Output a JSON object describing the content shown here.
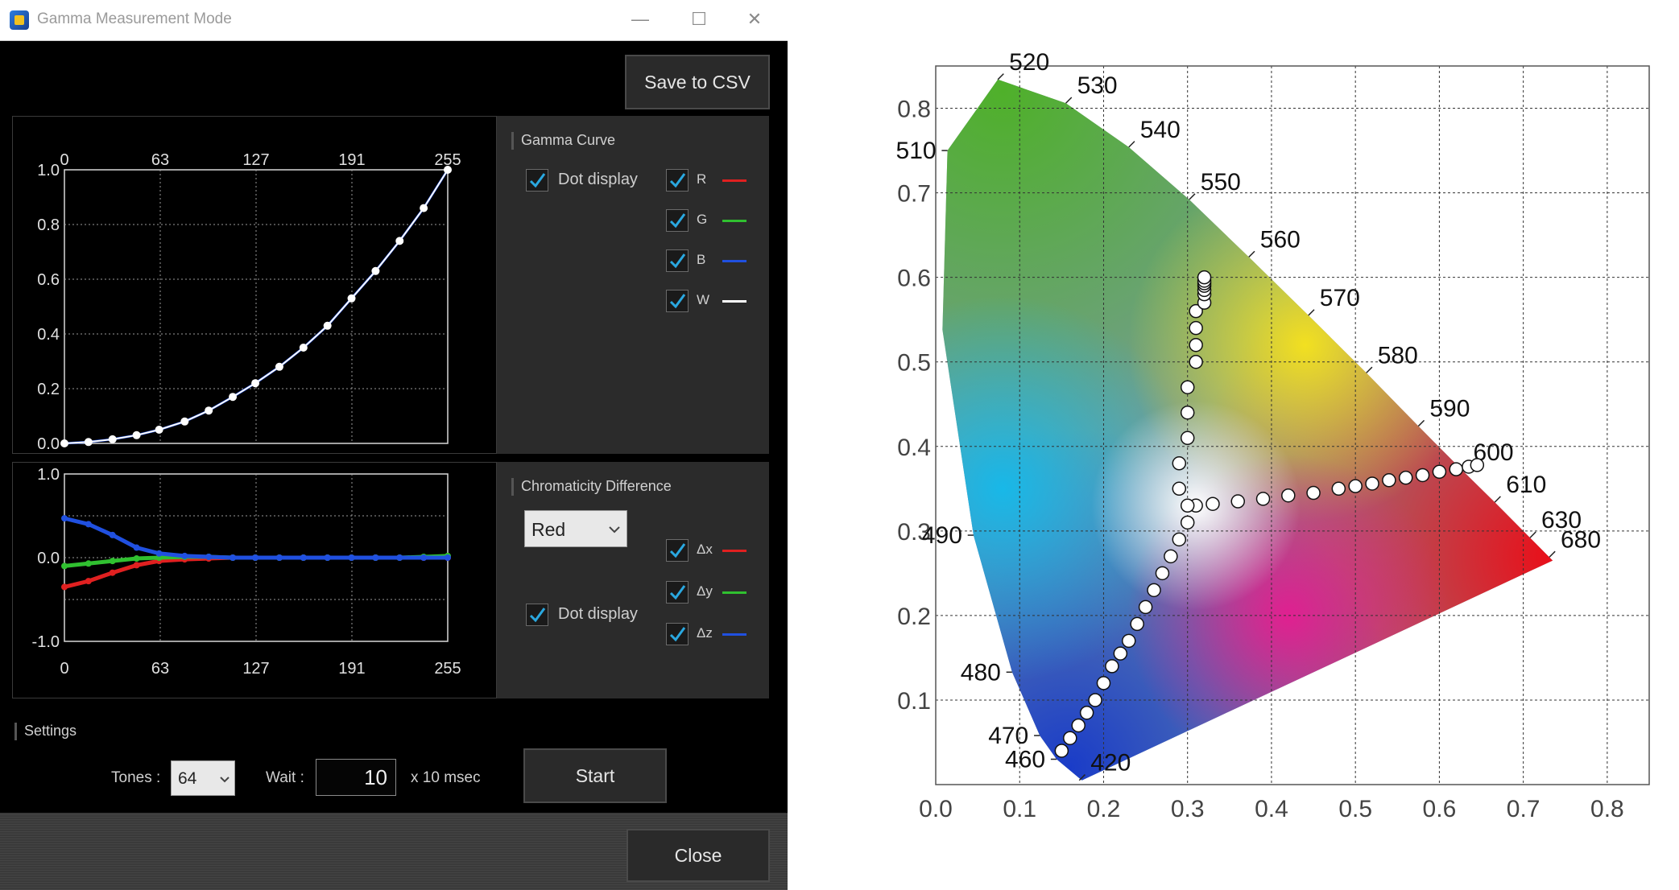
{
  "window": {
    "title": "Gamma Measurement Mode",
    "minimize_glyph": "—",
    "maximize_glyph": "☐",
    "close_glyph": "✕"
  },
  "toolbar": {
    "save_csv_label": "Save to CSV"
  },
  "gamma_chart": {
    "top_ticks": [
      "0",
      "63",
      "127",
      "191",
      "255"
    ],
    "y_ticks": [
      "1.0",
      "0.8",
      "0.6",
      "0.4",
      "0.2",
      "0.0"
    ]
  },
  "gamma_panel": {
    "title": "Gamma Curve",
    "dot_display_label": "Dot display",
    "channels": [
      {
        "label": "R",
        "color": "#e02020"
      },
      {
        "label": "G",
        "color": "#30c030"
      },
      {
        "label": "B",
        "color": "#2050e0"
      },
      {
        "label": "W",
        "color": "#ffffff"
      }
    ]
  },
  "diff_chart": {
    "y_ticks": [
      "1.0",
      "0.0",
      "-1.0"
    ],
    "x_ticks": [
      "0",
      "63",
      "127",
      "191",
      "255"
    ]
  },
  "diff_panel": {
    "title": "Chromaticity Difference",
    "color_select_value": "Red",
    "dot_display_label": "Dot display",
    "channels": [
      {
        "label": "Δx",
        "color": "#e02020"
      },
      {
        "label": "Δy",
        "color": "#30c030"
      },
      {
        "label": "Δz",
        "color": "#2050e0"
      }
    ]
  },
  "settings": {
    "title": "Settings",
    "tones_label": "Tones :",
    "tones_value": "64",
    "wait_label": "Wait :",
    "wait_value": "10",
    "wait_unit": "x  10 msec",
    "start_label": "Start"
  },
  "footer": {
    "close_label": "Close"
  },
  "chart_data": [
    {
      "type": "line",
      "x": [
        0,
        16,
        32,
        48,
        63,
        80,
        96,
        112,
        127,
        143,
        159,
        175,
        191,
        207,
        223,
        239,
        255
      ],
      "series": [
        {
          "name": "W",
          "values": [
            0.0,
            0.005,
            0.015,
            0.03,
            0.05,
            0.08,
            0.12,
            0.17,
            0.22,
            0.28,
            0.35,
            0.43,
            0.53,
            0.63,
            0.74,
            0.86,
            1.0
          ]
        }
      ],
      "xlim": [
        0,
        255
      ],
      "ylim": [
        0,
        1.0
      ],
      "grid": true
    },
    {
      "type": "line",
      "x": [
        0,
        16,
        32,
        48,
        63,
        80,
        96,
        112,
        127,
        143,
        159,
        175,
        191,
        207,
        223,
        239,
        255
      ],
      "series": [
        {
          "name": "Δx",
          "values": [
            -0.35,
            -0.28,
            -0.18,
            -0.09,
            -0.04,
            -0.02,
            -0.01,
            0.0,
            0.0,
            0.0,
            0.0,
            0.0,
            0.0,
            0.0,
            0.0,
            0.0,
            0.0
          ]
        },
        {
          "name": "Δy",
          "values": [
            -0.1,
            -0.07,
            -0.04,
            -0.01,
            0.0,
            0.01,
            0.01,
            0.0,
            0.0,
            0.0,
            0.0,
            0.0,
            0.0,
            0.0,
            0.0,
            0.01,
            0.02
          ]
        },
        {
          "name": "Δz",
          "values": [
            0.47,
            0.4,
            0.27,
            0.12,
            0.05,
            0.02,
            0.01,
            0.0,
            0.0,
            0.0,
            0.0,
            0.0,
            0.0,
            0.0,
            0.0,
            0.0,
            0.0
          ]
        }
      ],
      "xlim": [
        0,
        255
      ],
      "ylim": [
        -1.0,
        1.0
      ],
      "grid": true
    },
    {
      "type": "scatter",
      "x_ticks": [
        "0.0",
        "0.1",
        "0.2",
        "0.3",
        "0.4",
        "0.5",
        "0.6",
        "0.7",
        "0.8"
      ],
      "y_ticks": [
        "0.1",
        "0.2",
        "0.3",
        "0.4",
        "0.5",
        "0.6",
        "0.7",
        "0.8"
      ],
      "wavelength_labels": [
        {
          "label": "520",
          "x": 0.074,
          "y": 0.834
        },
        {
          "label": "530",
          "x": 0.155,
          "y": 0.806
        },
        {
          "label": "540",
          "x": 0.23,
          "y": 0.754
        },
        {
          "label": "550",
          "x": 0.302,
          "y": 0.692
        },
        {
          "label": "560",
          "x": 0.373,
          "y": 0.624
        },
        {
          "label": "570",
          "x": 0.444,
          "y": 0.555
        },
        {
          "label": "580",
          "x": 0.513,
          "y": 0.487
        },
        {
          "label": "590",
          "x": 0.575,
          "y": 0.424
        },
        {
          "label": "600",
          "x": 0.627,
          "y": 0.372
        },
        {
          "label": "610",
          "x": 0.666,
          "y": 0.334
        },
        {
          "label": "630",
          "x": 0.708,
          "y": 0.292
        },
        {
          "label": "680",
          "x": 0.731,
          "y": 0.269
        },
        {
          "label": "510",
          "x": 0.014,
          "y": 0.75
        },
        {
          "label": "490",
          "x": 0.045,
          "y": 0.295
        },
        {
          "label": "480",
          "x": 0.091,
          "y": 0.133
        },
        {
          "label": "470",
          "x": 0.124,
          "y": 0.058
        },
        {
          "label": "460",
          "x": 0.144,
          "y": 0.03
        },
        {
          "label": "420",
          "x": 0.171,
          "y": 0.005
        }
      ],
      "locus": {
        "x": [
          0.1741,
          0.144,
          0.124,
          0.091,
          0.045,
          0.008,
          0.014,
          0.074,
          0.155,
          0.23,
          0.302,
          0.373,
          0.444,
          0.513,
          0.575,
          0.627,
          0.666,
          0.708,
          0.735
        ],
        "y": [
          0.005,
          0.03,
          0.058,
          0.133,
          0.295,
          0.538,
          0.75,
          0.834,
          0.806,
          0.754,
          0.692,
          0.624,
          0.555,
          0.487,
          0.424,
          0.372,
          0.334,
          0.292,
          0.265
        ]
      },
      "series": [
        {
          "name": "B",
          "x": [
            0.31,
            0.3,
            0.29,
            0.28,
            0.27,
            0.26,
            0.25,
            0.24,
            0.23,
            0.22,
            0.21,
            0.2,
            0.19,
            0.18,
            0.17,
            0.16,
            0.15
          ],
          "y": [
            0.33,
            0.31,
            0.29,
            0.27,
            0.25,
            0.23,
            0.21,
            0.19,
            0.17,
            0.155,
            0.14,
            0.12,
            0.1,
            0.085,
            0.07,
            0.055,
            0.04
          ]
        },
        {
          "name": "G",
          "x": [
            0.29,
            0.29,
            0.3,
            0.3,
            0.3,
            0.31,
            0.31,
            0.31,
            0.31,
            0.32,
            0.32,
            0.32,
            0.32,
            0.32,
            0.32,
            0.32
          ],
          "y": [
            0.35,
            0.38,
            0.41,
            0.44,
            0.47,
            0.5,
            0.52,
            0.54,
            0.56,
            0.57,
            0.58,
            0.585,
            0.59,
            0.593,
            0.596,
            0.6
          ]
        },
        {
          "name": "R",
          "x": [
            0.3,
            0.33,
            0.36,
            0.39,
            0.42,
            0.45,
            0.48,
            0.5,
            0.52,
            0.54,
            0.56,
            0.58,
            0.6,
            0.62,
            0.635,
            0.645
          ],
          "y": [
            0.33,
            0.332,
            0.335,
            0.338,
            0.342,
            0.345,
            0.35,
            0.353,
            0.356,
            0.36,
            0.363,
            0.366,
            0.37,
            0.373,
            0.376,
            0.378
          ]
        }
      ],
      "xlim": [
        0.0,
        0.85
      ],
      "ylim": [
        0.0,
        0.85
      ],
      "grid": true
    }
  ]
}
